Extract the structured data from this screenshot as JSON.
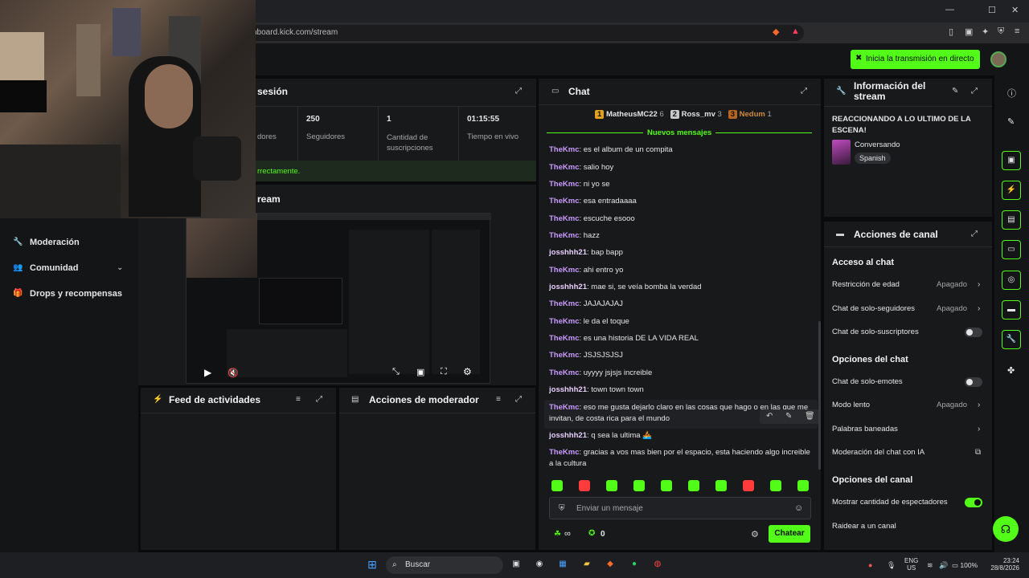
{
  "browser": {
    "url": "hboard.kick.com/stream",
    "window_controls": [
      "—",
      "☐",
      "✕"
    ]
  },
  "topbar": {
    "go_live_label": "Inicia la transmisión en directo"
  },
  "sidebar": {
    "items": [
      {
        "label": "Moderación"
      },
      {
        "label": "Comunidad"
      },
      {
        "label": "Drops y recompensas"
      }
    ]
  },
  "session": {
    "title": "sesión",
    "stats": [
      {
        "value": "",
        "label": "dores"
      },
      {
        "value": "250",
        "label": "Seguidores"
      },
      {
        "value": "1",
        "label": "Cantidad de suscripciones"
      },
      {
        "value": "01:15:55",
        "label": "Tiempo en vivo"
      }
    ],
    "status_text": "rrectamente."
  },
  "stream_preview": {
    "title": "ream"
  },
  "activity_feed": {
    "title": "Feed de actividades"
  },
  "mod_actions": {
    "title": "Acciones de moderador"
  },
  "chat": {
    "title": "Chat",
    "leaderboard": [
      {
        "rank": "1",
        "name": "MatheusMC22",
        "count": "6"
      },
      {
        "rank": "2",
        "name": "Ross_mv",
        "count": "3"
      },
      {
        "rank": "3",
        "name": "Nedum",
        "count": "1"
      }
    ],
    "new_messages_label": "Nuevos mensajes",
    "messages": [
      {
        "user": "TheKmc",
        "text": "es el album de un compita"
      },
      {
        "user": "TheKmc",
        "text": "salio hoy"
      },
      {
        "user": "TheKmc",
        "text": "ni yo se"
      },
      {
        "user": "TheKmc",
        "text": "esa entradaaaa"
      },
      {
        "user": "TheKmc",
        "text": "escuche esooo"
      },
      {
        "user": "TheKmc",
        "text": "hazz"
      },
      {
        "user": "josshhh21",
        "text": "bap bapp"
      },
      {
        "user": "TheKmc",
        "text": "ahi entro yo"
      },
      {
        "user": "josshhh21",
        "text": "mae si, se veía bomba la verdad"
      },
      {
        "user": "TheKmc",
        "text": "JAJAJAJAJ"
      },
      {
        "user": "TheKmc",
        "text": "le da el toque"
      },
      {
        "user": "TheKmc",
        "text": "es una historia DE LA VIDA REAL"
      },
      {
        "user": "TheKmc",
        "text": "JSJSJSJSJ"
      },
      {
        "user": "TheKmc",
        "text": "uyyyy jsjsjs increible"
      },
      {
        "user": "josshhh21",
        "text": "town town town"
      },
      {
        "user": "TheKmc",
        "text": "eso me gusta dejarlo claro en las cosas que hago o en las que me invitan, de costa rica para el mundo"
      },
      {
        "user": "josshhh21",
        "text": "q sea la ultima 🚣"
      },
      {
        "user": "TheKmc",
        "text": "gracias a vos mas bien por el espacio, esta haciendo algo increible a la cultura"
      }
    ],
    "input_placeholder": "Enviar un mensaje",
    "viewers_label": "∞",
    "points_label": "0",
    "send_label": "Chatear"
  },
  "stream_info": {
    "title": "Información del stream",
    "stream_title": "REACCIONANDO A LO ULTIMO DE LA ESCENA!",
    "category": "Conversando",
    "language_tag": "Spanish"
  },
  "channel_actions": {
    "title": "Acciones de canal",
    "sections": [
      {
        "heading": "Acceso al chat",
        "rows": [
          {
            "label": "Restricción de edad",
            "value": "Apagado",
            "control": "chevron"
          },
          {
            "label": "Chat de solo-seguidores",
            "value": "Apagado",
            "control": "chevron"
          },
          {
            "label": "Chat de solo-suscriptores",
            "value": "",
            "control": "toggle-off"
          }
        ]
      },
      {
        "heading": "Opciones del chat",
        "rows": [
          {
            "label": "Chat de solo-emotes",
            "value": "",
            "control": "toggle-off"
          },
          {
            "label": "Modo lento",
            "value": "Apagado",
            "control": "chevron"
          },
          {
            "label": "Palabras baneadas",
            "value": "",
            "control": "chevron"
          },
          {
            "label": "Moderación del chat con IA",
            "value": "",
            "control": "external"
          }
        ]
      },
      {
        "heading": "Opciones del canal",
        "rows": [
          {
            "label": "Mostrar cantidad de espectadores",
            "value": "",
            "control": "toggle-on"
          },
          {
            "label": "Raidear a un canal",
            "value": "",
            "control": "none"
          }
        ]
      }
    ]
  },
  "taskbar": {
    "search_placeholder": "Buscar",
    "lang_line1": "ENG",
    "lang_line2": "US",
    "battery": "100%",
    "time": "23:24",
    "date": "28/8/2026"
  },
  "colors": {
    "accent": "#53fc18",
    "panel": "#18191b",
    "background": "#0b0b0d"
  }
}
